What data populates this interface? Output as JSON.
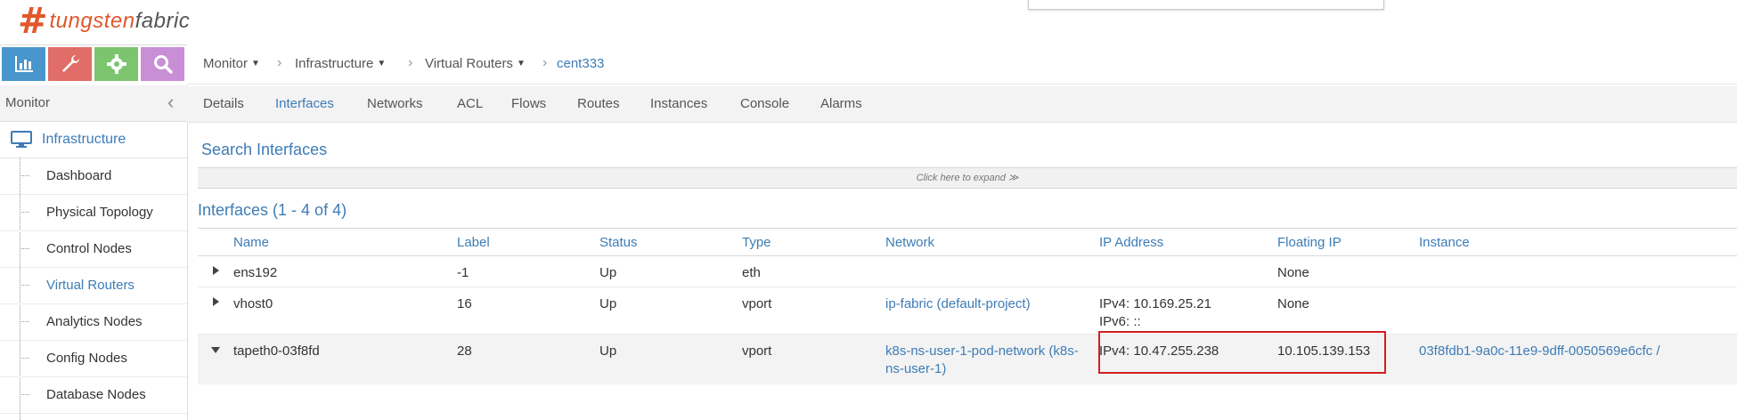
{
  "brand": {
    "logo_text_1": "tungsten",
    "logo_text_2": "fabric",
    "logo_icon": "tungsten-fabric-logo-icon"
  },
  "nav_icons": [
    {
      "name": "monitor",
      "icon": "bar-chart-icon",
      "color": "#4896cc"
    },
    {
      "name": "configure",
      "icon": "wrench-icon",
      "color": "#e06d67"
    },
    {
      "name": "settings",
      "icon": "gear-icon",
      "color": "#7cc46e"
    },
    {
      "name": "query",
      "icon": "search-icon",
      "color": "#c88fd6"
    }
  ],
  "sidebar": {
    "title": "Monitor",
    "section": "Infrastructure",
    "items": [
      {
        "label": "Dashboard"
      },
      {
        "label": "Physical Topology"
      },
      {
        "label": "Control Nodes"
      },
      {
        "label": "Virtual Routers",
        "active": true
      },
      {
        "label": "Analytics Nodes"
      },
      {
        "label": "Config Nodes"
      },
      {
        "label": "Database Nodes"
      }
    ]
  },
  "breadcrumb": {
    "items": [
      "Monitor",
      "Infrastructure",
      "Virtual Routers"
    ],
    "current": "cent333"
  },
  "tabs": [
    {
      "label": "Details"
    },
    {
      "label": "Interfaces",
      "active": true
    },
    {
      "label": "Networks"
    },
    {
      "label": "ACL"
    },
    {
      "label": "Flows"
    },
    {
      "label": "Routes"
    },
    {
      "label": "Instances"
    },
    {
      "label": "Console"
    },
    {
      "label": "Alarms"
    }
  ],
  "search": {
    "title": "Search Interfaces",
    "expand_text": "Click here to expand ≫"
  },
  "grid": {
    "title": "Interfaces (1 - 4 of 4)",
    "columns": [
      "Name",
      "Label",
      "Status",
      "Type",
      "Network",
      "IP Address",
      "Floating IP",
      "Instance"
    ],
    "rows": [
      {
        "expanded": false,
        "name": "ens192",
        "label": "-1",
        "status": "Up",
        "type": "eth",
        "network": "",
        "ip_line1": "",
        "ip_line2": "",
        "floating_ip": "None",
        "instance": ""
      },
      {
        "expanded": false,
        "name": "vhost0",
        "label": "16",
        "status": "Up",
        "type": "vport",
        "network": "ip-fabric (default-project)",
        "ip_line1": "IPv4: 10.169.25.21",
        "ip_line2": "IPv6: ::",
        "floating_ip": "None",
        "instance": ""
      },
      {
        "expanded": true,
        "name": "tapeth0-03f8fd",
        "label": "28",
        "status": "Up",
        "type": "vport",
        "network_line1": "k8s-ns-user-1-pod-network (k8s-",
        "network_line2": "ns-user-1)",
        "ip_line1": "IPv4: 10.47.255.238",
        "ip_line2": "",
        "floating_ip": "10.105.139.153",
        "instance": "03f8fdb1-9a0c-11e9-9dff-0050569e6cfc /"
      }
    ]
  },
  "colors": {
    "accent": "#3d7cb6",
    "highlight_box": "#d21f1f",
    "logo": "#e2572b"
  }
}
